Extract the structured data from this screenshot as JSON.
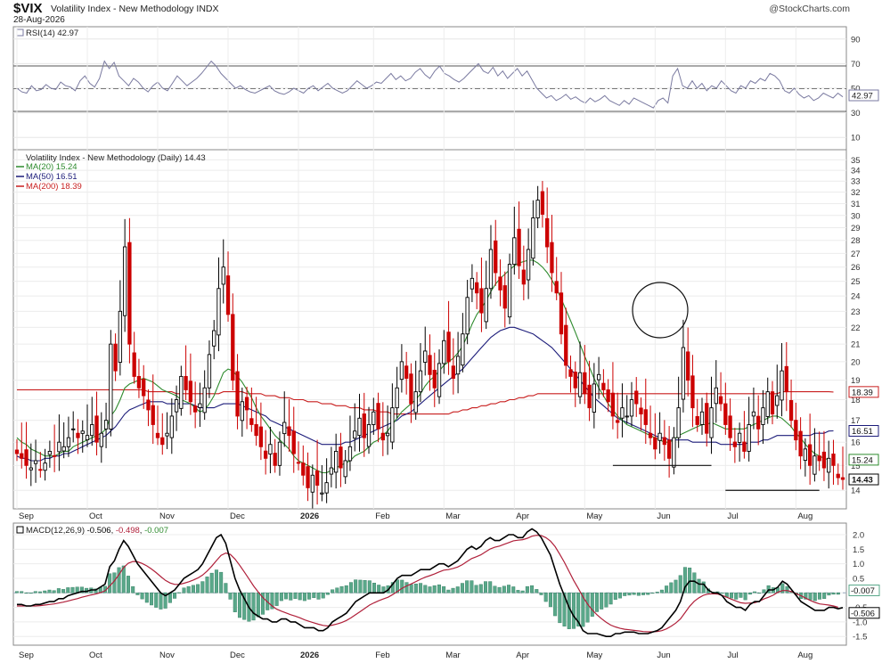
{
  "header": {
    "symbol": "$VIX",
    "name": "Volatility Index - New Methodology INDX",
    "date": "28-Aug-2026",
    "brand": "@StockCharts.com"
  },
  "colors": {
    "up": "#000000",
    "down": "#cc0000",
    "ma20": "#2e8b2e",
    "ma50": "#1c1c7a",
    "ma200": "#c81e1e",
    "rsi": "#7a7aa0",
    "macd": "#000000",
    "signal": "#b0203a",
    "hist": "#5aa88a"
  },
  "chart_data": [
    {
      "type": "line",
      "panel": "RSI",
      "legend": {
        "label": "RSI(14)",
        "value": "42.97"
      },
      "ylim": [
        0,
        100
      ],
      "y_ticks": [
        "90",
        "70",
        "50",
        "30",
        "10"
      ],
      "reference_lines": [
        70,
        50,
        30
      ],
      "last_value": "42.97",
      "values": [
        50,
        47,
        46,
        52,
        48,
        49,
        53,
        50,
        49,
        55,
        52,
        51,
        48,
        56,
        60,
        54,
        51,
        58,
        72,
        66,
        71,
        60,
        56,
        52,
        58,
        55,
        50,
        47,
        52,
        55,
        50,
        48,
        54,
        60,
        56,
        52,
        55,
        58,
        62,
        67,
        72,
        68,
        62,
        58,
        54,
        50,
        52,
        49,
        47,
        46,
        48,
        50,
        52,
        48,
        46,
        45,
        47,
        50,
        48,
        46,
        50,
        52,
        48,
        51,
        54,
        50,
        48,
        46,
        48,
        52,
        56,
        53,
        50,
        52,
        55,
        54,
        58,
        62,
        57,
        60,
        56,
        58,
        63,
        66,
        61,
        58,
        64,
        68,
        62,
        60,
        57,
        55,
        58,
        62,
        66,
        70,
        64,
        62,
        67,
        60,
        64,
        58,
        62,
        66,
        60,
        64,
        57,
        50,
        46,
        42,
        44,
        40,
        42,
        45,
        41,
        43,
        40,
        38,
        42,
        39,
        41,
        44,
        40,
        38,
        36,
        40,
        37,
        42,
        40,
        38,
        36,
        34,
        40,
        42,
        38,
        60,
        66,
        52,
        50,
        56,
        50,
        54,
        48,
        52,
        50,
        56,
        52,
        48,
        46,
        52,
        50,
        56,
        54,
        58,
        56,
        62,
        60,
        56,
        48,
        46,
        50,
        45,
        42,
        44,
        40,
        42,
        46,
        44,
        42,
        46,
        43
      ]
    },
    {
      "type": "candlestick",
      "panel": "price",
      "title": "Volatility Index - New Methodology (Daily)",
      "last_value": "14.43",
      "ylim": [
        13.3,
        36
      ],
      "y_ticks": [
        "35",
        "34",
        "33",
        "32",
        "31",
        "30",
        "29",
        "28",
        "27",
        "26",
        "25",
        "24",
        "23",
        "22",
        "21",
        "20",
        "19",
        "18",
        "17",
        "16",
        "15",
        "14"
      ],
      "x_labels": [
        "Sep",
        "Oct",
        "Nov",
        "Dec",
        "2026",
        "Feb",
        "Mar",
        "Apr",
        "May",
        "Jun",
        "Jul",
        "Aug"
      ],
      "series": [
        {
          "name": "MA(20)",
          "label": "MA(20) 15.24",
          "last": "15.24"
        },
        {
          "name": "MA(50)",
          "label": "MA(50) 16.51",
          "last": "16.51"
        },
        {
          "name": "MA(200)",
          "label": "MA(200) 18.39",
          "last": "18.39"
        }
      ],
      "closes": [
        15.5,
        15.3,
        15.0,
        14.9,
        15.2,
        14.8,
        15.1,
        15.6,
        15.4,
        16.0,
        15.8,
        16.2,
        16.6,
        16.2,
        16.5,
        16.3,
        16.8,
        16.0,
        16.4,
        17.0,
        21.0,
        19.5,
        23.0,
        27.5,
        21.0,
        19.2,
        18.6,
        18.2,
        17.5,
        16.8,
        16.2,
        15.9,
        16.4,
        17.2,
        18.0,
        19.2,
        18.5,
        17.9,
        17.4,
        17.8,
        18.6,
        20.4,
        21.8,
        24.5,
        26.0,
        22.8,
        19.0,
        17.2,
        17.9,
        17.5,
        16.8,
        16.3,
        15.8,
        15.3,
        15.9,
        15.0,
        16.0,
        16.9,
        16.3,
        15.5,
        15.1,
        14.6,
        14.1,
        14.6,
        14.2,
        13.9,
        14.3,
        14.9,
        15.6,
        14.9,
        15.2,
        15.8,
        16.5,
        17.1,
        16.2,
        16.8,
        17.4,
        16.6,
        16.1,
        16.4,
        17.6,
        18.6,
        20.0,
        19.1,
        17.8,
        18.4,
        19.5,
        20.6,
        19.3,
        18.6,
        19.9,
        21.2,
        20.0,
        19.1,
        20.3,
        21.6,
        23.9,
        25.2,
        24.2,
        22.9,
        24.5,
        27.3,
        25.6,
        24.4,
        23.2,
        26.2,
        28.2,
        26.1,
        24.8,
        27.3,
        29.8,
        31.3,
        30.1,
        27.5,
        25.6,
        24.2,
        21.6,
        19.8,
        19.2,
        18.6,
        19.4,
        18.3,
        17.6,
        18.8,
        19.3,
        18.5,
        17.9,
        17.2,
        16.9,
        17.6,
        17.2,
        18.0,
        17.8,
        17.3,
        16.8,
        16.2,
        15.7,
        16.4,
        15.9,
        15.3,
        16.2,
        17.6,
        20.8,
        19.0,
        17.6,
        16.8,
        17.4,
        16.4,
        17.6,
        18.6,
        17.8,
        16.8,
        16.2,
        15.8,
        16.4,
        15.6,
        16.8,
        17.4,
        16.6,
        17.6,
        18.4,
        17.3,
        18.2,
        19.5,
        18.4,
        17.0,
        16.1,
        15.4,
        15.7,
        15.0,
        15.4,
        15.2,
        14.9,
        15.3,
        15.0,
        14.5,
        14.43
      ],
      "ma20": [
        16.2,
        16.0,
        15.9,
        15.7,
        15.6,
        15.5,
        15.4,
        15.4,
        15.4,
        15.5,
        15.6,
        15.6,
        15.8,
        15.9,
        16.0,
        16.1,
        16.2,
        16.3,
        16.4,
        16.6,
        17.2,
        17.5,
        18.0,
        18.6,
        18.8,
        18.9,
        19.0,
        19.1,
        19.0,
        18.9,
        18.7,
        18.5,
        18.4,
        18.3,
        18.2,
        18.0,
        17.9,
        17.8,
        17.6,
        17.4,
        17.5,
        17.8,
        18.2,
        18.8,
        19.4,
        19.6,
        19.5,
        19.2,
        18.9,
        18.5,
        18.1,
        17.6,
        17.2,
        16.9,
        16.6,
        16.3,
        16.1,
        15.9,
        15.7,
        15.4,
        15.2,
        15.1,
        15.0,
        14.9,
        14.8,
        14.7,
        14.7,
        14.8,
        14.9,
        15.0,
        15.1,
        15.2,
        15.4,
        15.5,
        15.6,
        15.8,
        16.0,
        16.1,
        16.3,
        16.5,
        16.8,
        17.1,
        17.4,
        17.6,
        17.8,
        18.0,
        18.3,
        18.7,
        19.0,
        19.2,
        19.5,
        19.8,
        20.0,
        20.2,
        20.5,
        20.9,
        21.5,
        22.2,
        22.8,
        23.2,
        23.7,
        24.3,
        24.8,
        25.2,
        25.5,
        25.8,
        26.1,
        26.3,
        26.4,
        26.5,
        26.5,
        26.3,
        26.0,
        25.6,
        25.1,
        24.5,
        23.8,
        23.1,
        22.4,
        21.7,
        21.0,
        20.3,
        19.7,
        19.1,
        18.6,
        18.2,
        17.8,
        17.5,
        17.2,
        17.0,
        16.8,
        16.7,
        16.6,
        16.5,
        16.4,
        16.3,
        16.2,
        16.1,
        16.0,
        16.0,
        16.1,
        16.3,
        16.4,
        16.5,
        16.6,
        16.7,
        16.8,
        16.8,
        16.9,
        16.8,
        16.7,
        16.6,
        16.6,
        16.6,
        16.6,
        16.6,
        16.7,
        16.8,
        16.9,
        17.0,
        17.1,
        17.2,
        17.2,
        17.1,
        16.9,
        16.7,
        16.4,
        16.2,
        15.9,
        15.7,
        15.5,
        15.4,
        15.3,
        15.24
      ],
      "ma50": [
        15.4,
        15.3,
        15.3,
        15.2,
        15.2,
        15.2,
        15.3,
        15.3,
        15.4,
        15.4,
        15.5,
        15.5,
        15.6,
        15.7,
        15.8,
        15.9,
        16.0,
        16.1,
        16.2,
        16.3,
        16.5,
        16.7,
        17.0,
        17.3,
        17.5,
        17.6,
        17.7,
        17.8,
        17.9,
        17.9,
        17.9,
        17.9,
        17.8,
        17.8,
        17.8,
        17.8,
        17.8,
        17.8,
        17.7,
        17.6,
        17.6,
        17.6,
        17.6,
        17.7,
        17.8,
        17.8,
        17.8,
        17.8,
        17.7,
        17.6,
        17.5,
        17.4,
        17.3,
        17.2,
        17.0,
        16.9,
        16.8,
        16.7,
        16.6,
        16.5,
        16.4,
        16.3,
        16.2,
        16.1,
        16.0,
        15.9,
        15.9,
        15.9,
        15.9,
        15.9,
        16.0,
        16.0,
        16.1,
        16.2,
        16.3,
        16.4,
        16.5,
        16.6,
        16.7,
        16.8,
        16.9,
        17.0,
        17.2,
        17.3,
        17.4,
        17.6,
        17.8,
        18.0,
        18.2,
        18.4,
        18.6,
        18.8,
        19.0,
        19.2,
        19.4,
        19.6,
        19.9,
        20.2,
        20.5,
        20.8,
        21.1,
        21.4,
        21.6,
        21.8,
        21.9,
        22.0,
        22.0,
        21.9,
        21.8,
        21.7,
        21.6,
        21.4,
        21.2,
        21.0,
        20.8,
        20.5,
        20.2,
        19.9,
        19.6,
        19.3,
        19.0,
        18.7,
        18.4,
        18.1,
        17.9,
        17.7,
        17.5,
        17.3,
        17.1,
        17.0,
        16.9,
        16.8,
        16.7,
        16.6,
        16.5,
        16.4,
        16.3,
        16.2,
        16.2,
        16.1,
        16.1,
        16.1,
        16.1,
        16.1,
        16.0,
        16.0,
        16.0,
        16.0,
        16.0,
        16.0,
        15.9,
        15.9,
        15.9,
        15.9,
        15.9,
        15.9,
        16.0,
        16.0,
        16.0,
        16.1,
        16.1,
        16.2,
        16.3,
        16.3,
        16.3,
        16.3,
        16.3,
        16.3,
        16.3,
        16.3,
        16.4,
        16.4,
        16.4,
        16.5,
        16.51
      ],
      "ma200": [
        18.5,
        18.5,
        18.5,
        18.5,
        18.5,
        18.5,
        18.5,
        18.5,
        18.5,
        18.5,
        18.5,
        18.5,
        18.5,
        18.5,
        18.5,
        18.5,
        18.5,
        18.5,
        18.5,
        18.5,
        18.5,
        18.5,
        18.5,
        18.5,
        18.5,
        18.5,
        18.5,
        18.5,
        18.4,
        18.4,
        18.4,
        18.4,
        18.4,
        18.4,
        18.3,
        18.3,
        18.3,
        18.3,
        18.3,
        18.3,
        18.3,
        18.3,
        18.3,
        18.3,
        18.4,
        18.4,
        18.4,
        18.4,
        18.4,
        18.3,
        18.3,
        18.3,
        18.3,
        18.2,
        18.2,
        18.2,
        18.1,
        18.1,
        18.1,
        18.0,
        18.0,
        18.0,
        17.9,
        17.9,
        17.9,
        17.8,
        17.8,
        17.8,
        17.7,
        17.7,
        17.7,
        17.6,
        17.6,
        17.6,
        17.5,
        17.5,
        17.5,
        17.4,
        17.4,
        17.4,
        17.3,
        17.3,
        17.3,
        17.3,
        17.3,
        17.3,
        17.3,
        17.3,
        17.3,
        17.3,
        17.3,
        17.3,
        17.3,
        17.4,
        17.4,
        17.5,
        17.5,
        17.6,
        17.6,
        17.7,
        17.7,
        17.8,
        17.8,
        17.9,
        17.9,
        18.0,
        18.0,
        18.1,
        18.1,
        18.2,
        18.2,
        18.3,
        18.3,
        18.3,
        18.3,
        18.3,
        18.3,
        18.3,
        18.3,
        18.3,
        18.3,
        18.3,
        18.3,
        18.3,
        18.3,
        18.3,
        18.3,
        18.3,
        18.3,
        18.3,
        18.3,
        18.3,
        18.3,
        18.3,
        18.3,
        18.3,
        18.3,
        18.3,
        18.3,
        18.3,
        18.3,
        18.3,
        18.3,
        18.3,
        18.3,
        18.3,
        18.3,
        18.3,
        18.3,
        18.3,
        18.3,
        18.3,
        18.3,
        18.3,
        18.3,
        18.3,
        18.3,
        18.3,
        18.3,
        18.3,
        18.3,
        18.3,
        18.3,
        18.4,
        18.4,
        18.4,
        18.4,
        18.4,
        18.4,
        18.4,
        18.4,
        18.4,
        18.4,
        18.4,
        18.39
      ],
      "support_lines": [
        {
          "from_index": 127,
          "to_index": 148,
          "value": 15.0
        },
        {
          "from_index": 151,
          "to_index": 171,
          "value": 14.0
        }
      ]
    },
    {
      "type": "line",
      "panel": "MACD",
      "legend": {
        "label": "MACD(12,26,9)",
        "macd": "-0.506",
        "signal": "-0.498",
        "hist": "-0.007"
      },
      "ylim": [
        -1.8,
        2.4
      ],
      "y_ticks": [
        "2.0",
        "1.5",
        "1.0",
        "0.5",
        "0.0",
        "-0.5",
        "-1.0",
        "-1.5"
      ],
      "last_values": {
        "macd": "-0.506",
        "signal": "-0.498",
        "hist": "-0.007"
      },
      "macd": [
        -0.4,
        -0.4,
        -0.45,
        -0.45,
        -0.4,
        -0.4,
        -0.35,
        -0.3,
        -0.3,
        -0.2,
        -0.2,
        -0.1,
        -0.05,
        0.0,
        0.05,
        0.05,
        0.1,
        0.1,
        0.2,
        0.3,
        0.9,
        1.1,
        1.5,
        1.8,
        1.6,
        1.3,
        1.0,
        0.8,
        0.6,
        0.4,
        0.2,
        0.0,
        -0.1,
        0.0,
        0.1,
        0.3,
        0.5,
        0.6,
        0.7,
        0.8,
        1.0,
        1.3,
        1.6,
        1.9,
        2.0,
        1.7,
        1.1,
        0.5,
        0.1,
        -0.2,
        -0.5,
        -0.7,
        -0.8,
        -0.9,
        -0.9,
        -1.0,
        -1.0,
        -0.9,
        -0.9,
        -1.0,
        -1.0,
        -1.1,
        -1.2,
        -1.2,
        -1.2,
        -1.3,
        -1.3,
        -1.2,
        -1.0,
        -0.9,
        -0.8,
        -0.7,
        -0.5,
        -0.3,
        -0.2,
        -0.1,
        0.0,
        0.0,
        0.0,
        0.0,
        0.1,
        0.3,
        0.5,
        0.6,
        0.6,
        0.6,
        0.7,
        0.8,
        0.8,
        0.8,
        0.9,
        1.0,
        1.0,
        0.9,
        1.0,
        1.1,
        1.3,
        1.5,
        1.6,
        1.5,
        1.6,
        1.8,
        1.9,
        1.8,
        1.8,
        1.9,
        2.0,
        2.0,
        1.9,
        1.9,
        2.1,
        2.2,
        2.1,
        1.9,
        1.6,
        1.3,
        0.8,
        0.3,
        -0.1,
        -0.5,
        -0.8,
        -1.0,
        -1.3,
        -1.4,
        -1.4,
        -1.4,
        -1.45,
        -1.5,
        -1.5,
        -1.4,
        -1.4,
        -1.35,
        -1.35,
        -1.35,
        -1.4,
        -1.4,
        -1.4,
        -1.35,
        -1.3,
        -1.2,
        -1.0,
        -0.8,
        -0.6,
        -0.3,
        0.2,
        0.4,
        0.4,
        0.3,
        0.3,
        0.1,
        0.0,
        0.0,
        -0.1,
        -0.3,
        -0.4,
        -0.5,
        -0.5,
        -0.6,
        -0.4,
        -0.3,
        -0.3,
        -0.1,
        0.1,
        0.1,
        0.2,
        0.4,
        0.3,
        0.1,
        -0.1,
        -0.3,
        -0.4,
        -0.5,
        -0.6,
        -0.6,
        -0.6,
        -0.5,
        -0.5,
        -0.55,
        -0.506
      ],
      "signal": [
        -0.45,
        -0.45,
        -0.45,
        -0.45,
        -0.45,
        -0.44,
        -0.42,
        -0.4,
        -0.38,
        -0.35,
        -0.32,
        -0.28,
        -0.24,
        -0.2,
        -0.15,
        -0.11,
        -0.07,
        -0.04,
        0.01,
        0.07,
        0.24,
        0.41,
        0.63,
        0.87,
        1.02,
        1.08,
        1.07,
        1.01,
        0.93,
        0.82,
        0.7,
        0.56,
        0.43,
        0.34,
        0.29,
        0.29,
        0.33,
        0.38,
        0.44,
        0.51,
        0.61,
        0.75,
        0.92,
        1.11,
        1.29,
        1.37,
        1.32,
        1.16,
        0.95,
        0.72,
        0.48,
        0.24,
        0.03,
        -0.16,
        -0.31,
        -0.45,
        -0.56,
        -0.63,
        -0.69,
        -0.75,
        -0.8,
        -0.86,
        -0.93,
        -0.98,
        -1.03,
        -1.08,
        -1.12,
        -1.14,
        -1.11,
        -1.07,
        -1.02,
        -0.95,
        -0.86,
        -0.75,
        -0.64,
        -0.53,
        -0.42,
        -0.34,
        -0.27,
        -0.21,
        -0.15,
        -0.06,
        0.05,
        0.16,
        0.24,
        0.31,
        0.39,
        0.47,
        0.54,
        0.59,
        0.65,
        0.72,
        0.78,
        0.8,
        0.84,
        0.89,
        0.97,
        1.08,
        1.18,
        1.24,
        1.31,
        1.41,
        1.51,
        1.57,
        1.61,
        1.67,
        1.73,
        1.79,
        1.81,
        1.83,
        1.88,
        1.95,
        1.98,
        1.97,
        1.9,
        1.78,
        1.59,
        1.33,
        1.05,
        0.74,
        0.43,
        0.15,
        -0.14,
        -0.39,
        -0.59,
        -0.75,
        -0.89,
        -1.01,
        -1.11,
        -1.17,
        -1.22,
        -1.25,
        -1.27,
        -1.29,
        -1.31,
        -1.33,
        -1.34,
        -1.34,
        -1.33,
        -1.3,
        -1.24,
        -1.15,
        -1.04,
        -0.9,
        -0.68,
        -0.46,
        -0.29,
        -0.17,
        -0.08,
        -0.04,
        -0.03,
        -0.04,
        -0.09,
        -0.15,
        -0.22,
        -0.28,
        -0.34,
        -0.36,
        -0.35,
        -0.34,
        -0.29,
        -0.21,
        -0.15,
        -0.08,
        0.02,
        0.08,
        0.08,
        0.04,
        -0.03,
        -0.1,
        -0.18,
        -0.26,
        -0.33,
        -0.38,
        -0.4,
        -0.42,
        -0.45,
        -0.498
      ]
    }
  ]
}
